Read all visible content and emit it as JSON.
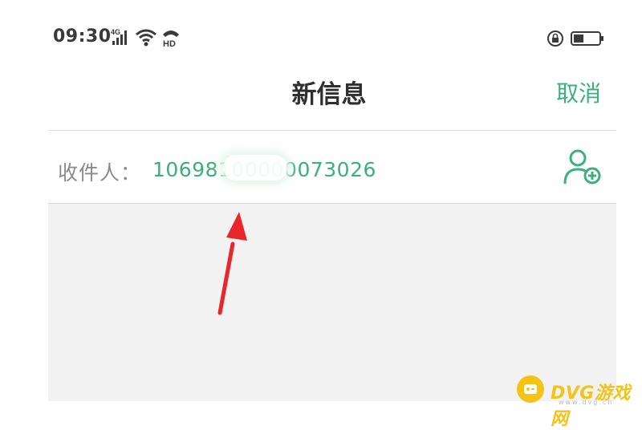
{
  "colors": {
    "accent": "#3bb07a",
    "compose_area": "#f2f2f2",
    "annotation_arrow": "#e8262b",
    "watermark": "#f3c316"
  },
  "status_bar": {
    "time": "09:30",
    "network_label": "4G",
    "hd_label": "HD",
    "icons": [
      "signal-icon",
      "wifi-icon",
      "hd-call-icon",
      "orientation-lock-icon",
      "battery-icon"
    ]
  },
  "nav": {
    "title": "新信息",
    "cancel_label": "取消"
  },
  "recipient": {
    "label": "收件人：",
    "value": "10698100000073026",
    "add_contact_icon": "add-contact-icon"
  },
  "watermark": {
    "text": "DVG游戏网",
    "sub": "www.dvg.cn"
  }
}
